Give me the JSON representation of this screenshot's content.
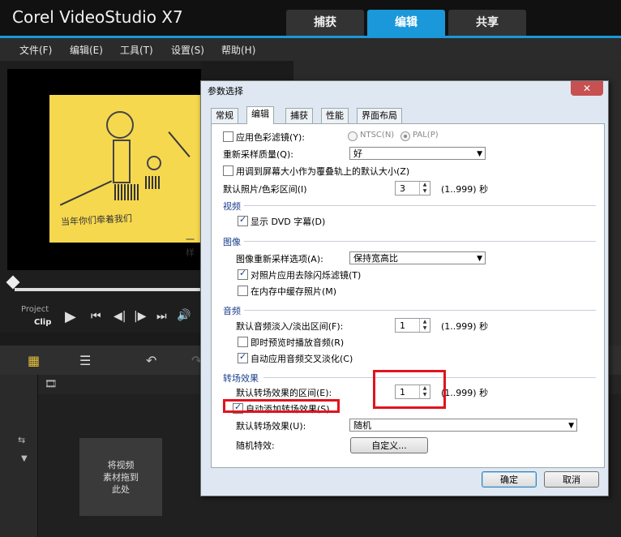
{
  "app": {
    "title": "Corel VideoStudio X7",
    "tabs": [
      {
        "label": "捕获"
      },
      {
        "label": "编辑"
      },
      {
        "label": "共享"
      }
    ],
    "menu": [
      {
        "label": "文件(F)"
      },
      {
        "label": "编辑(E)"
      },
      {
        "label": "工具(T)"
      },
      {
        "label": "设置(S)"
      },
      {
        "label": "帮助(H)"
      }
    ],
    "preview": {
      "caption": "当年你们牵着我们",
      "caption2": "一样",
      "mode_project": "Project",
      "mode_clip": "Clip"
    },
    "drop_zone": "将视频\n素材拖到\n此处"
  },
  "dialog": {
    "title": "参数选择",
    "close": "✕",
    "tabs": [
      {
        "label": "常规"
      },
      {
        "label": "编辑"
      },
      {
        "label": "捕获"
      },
      {
        "label": "性能"
      },
      {
        "label": "界面布局"
      }
    ],
    "general": {
      "apply_color_filter": "应用色彩滤镜(Y):",
      "ntsc": "NTSC(N)",
      "pal": "PAL(P)",
      "resample_quality_label": "重新采样质量(Q):",
      "resample_quality_value": "好",
      "fit_overlay": "用调到屏幕大小作为覆叠轨上的默认大小(Z)",
      "default_photo_label": "默认照片/色彩区间(I)",
      "default_photo_value": "3",
      "default_photo_range": "(1..999) 秒"
    },
    "video": {
      "section": "视频",
      "show_dvd_subtitle": "显示 DVD 字幕(D)"
    },
    "image": {
      "section": "图像",
      "resample_option_label": "图像重新采样选项(A):",
      "resample_option_value": "保持宽高比",
      "flicker_filter": "对照片应用去除闪烁滤镜(T)",
      "cache_in_memory": "在内存中缓存照片(M)"
    },
    "audio": {
      "section": "音频",
      "fade_label": "默认音频淡入/淡出区间(F):",
      "fade_value": "1",
      "fade_range": "(1..999) 秒",
      "instant_preview": "即时预览时播放音频(R)",
      "auto_crossfade": "自动应用音频交叉淡化(C)"
    },
    "transition": {
      "section": "转场效果",
      "duration_label": "默认转场效果的区间(E):",
      "duration_value": "1",
      "duration_range": "(1..999) 秒",
      "auto_add": "自动添加转场效果(S)",
      "default_effect_label": "默认转场效果(U):",
      "default_effect_value": "随机",
      "random_effects_label": "随机特效:",
      "customize_button": "自定义..."
    },
    "ok": "确定",
    "cancel": "取消"
  }
}
